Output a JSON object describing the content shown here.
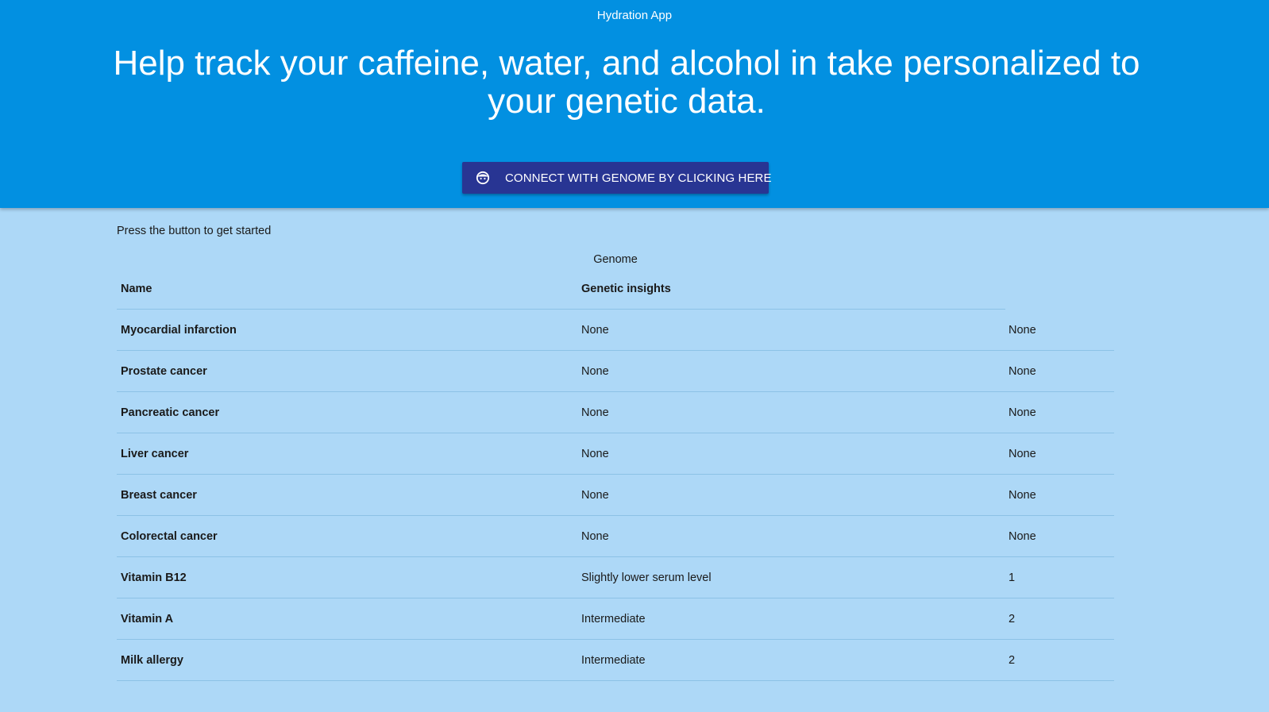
{
  "header": {
    "app_title": "Hydration App",
    "hero_heading": "Help track your caffeine, water, and alcohol in take personalized to your genetic data.",
    "connect_button_label": "CONNECT WITH GENOME BY CLICKING HERE",
    "connect_button_icon": "genome-face-icon"
  },
  "colors": {
    "header_bg": "#0290e1",
    "page_bg": "#add8f7",
    "button_bg": "#283593"
  },
  "main": {
    "intro_text": "Press the button to get started",
    "table": {
      "caption": "Genome",
      "columns": [
        "Name",
        "Genetic insights"
      ],
      "rows": [
        {
          "name": "Myocardial infarction",
          "insight": "None",
          "score": "None"
        },
        {
          "name": "Prostate cancer",
          "insight": "None",
          "score": "None"
        },
        {
          "name": "Pancreatic cancer",
          "insight": "None",
          "score": "None"
        },
        {
          "name": "Liver cancer",
          "insight": "None",
          "score": "None"
        },
        {
          "name": "Breast cancer",
          "insight": "None",
          "score": "None"
        },
        {
          "name": "Colorectal cancer",
          "insight": "None",
          "score": "None"
        },
        {
          "name": "Vitamin B12",
          "insight": "Slightly lower serum level",
          "score": "1"
        },
        {
          "name": "Vitamin A",
          "insight": "Intermediate",
          "score": "2"
        },
        {
          "name": "Milk allergy",
          "insight": "Intermediate",
          "score": "2"
        }
      ]
    }
  }
}
